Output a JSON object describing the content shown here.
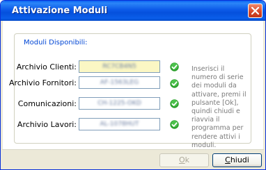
{
  "window": {
    "title": "Attivazione Moduli"
  },
  "group": {
    "legend": "Moduli Disponibili:"
  },
  "modules": [
    {
      "label": "Archivio Clienti:",
      "serial": "RC7CB4N5",
      "active": true
    },
    {
      "label": "Archivio Fornitori:",
      "serial": "AF-1563LEG",
      "active": false
    },
    {
      "label": "Comunicazioni:",
      "serial": "CH-1225-OKD",
      "active": false
    },
    {
      "label": "Archivio Lavori:",
      "serial": "AL-1078HUT",
      "active": false
    }
  ],
  "help_text": "Inserisci il numero di serie dei moduli da attivare, premi il pulsante [Ok], quindi chiudi e riavvia il programma per rendere attivi i moduli.",
  "buttons": {
    "ok": {
      "mnemonic": "O",
      "rest": "k",
      "enabled": false
    },
    "close": {
      "mnemonic": "C",
      "rest": "hiudi",
      "enabled": true
    }
  },
  "icons": {
    "check": "green-check-icon",
    "close": "close-icon"
  },
  "colors": {
    "title_bar": "#0550dc",
    "active_field": "#fbf7c4",
    "check": "#2ea02e",
    "legend": "#0046d5"
  }
}
